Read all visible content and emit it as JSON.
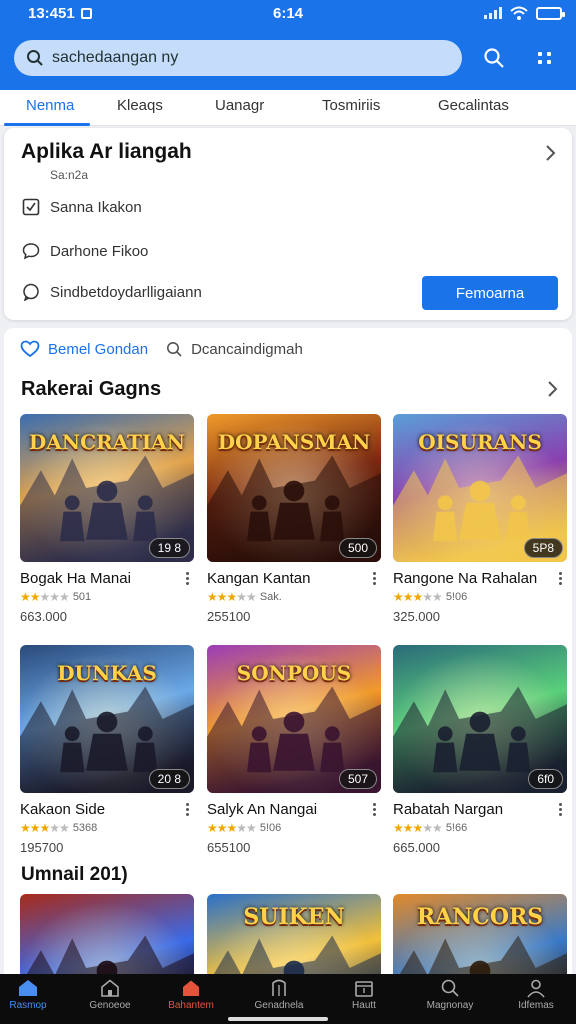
{
  "status": {
    "time": "13:451",
    "center_time": "6:14"
  },
  "search": {
    "query": "sachedaangan ny"
  },
  "tabs": [
    "Nenma",
    "Kleaqs",
    "Uanagr",
    "Tosmiriis",
    "Gecalintas"
  ],
  "app": {
    "title": "Aplika Ar liangah",
    "subtitle": "Sa:n2a",
    "rows": [
      "Sanna Ikakon",
      "Darhone Fikoo",
      "Sindbetdoydarlligaiann"
    ],
    "button": "Femoarna"
  },
  "filters": [
    "Bemel Gondan",
    "Dcancaindigmah"
  ],
  "section_title": "Rakerai Gagns",
  "year_title": "Umnail 201)",
  "games": [
    {
      "name": "Bogak Ha Manai",
      "badge": "19 8",
      "rating_text": "501",
      "stars": 2,
      "price": "663.000",
      "art": "DANCRATIAN",
      "palette": [
        "#3a6db0",
        "#e2a24a",
        "#2d2d4a"
      ]
    },
    {
      "name": "Kangan Kantan",
      "badge": "500",
      "rating_text": "Sak.",
      "stars": 3,
      "price": "255100",
      "art": "DOPANSMAN",
      "palette": [
        "#f09a2a",
        "#7b2a12",
        "#2a0f0a"
      ]
    },
    {
      "name": "Rangone Na Rahalan",
      "badge": "5P8",
      "rating_text": "5!06",
      "stars": 3,
      "price": "325.000",
      "art": "OISURANS",
      "palette": [
        "#5a9fd8",
        "#8a3fae",
        "#f2c64a"
      ]
    },
    {
      "name": "Kakaon Side",
      "badge": "20 8",
      "rating_text": "5368",
      "stars": 3,
      "price": "195700",
      "art": "DUNKAS",
      "palette": [
        "#2b4a7a",
        "#6aa8e8",
        "#1a1a2a"
      ]
    },
    {
      "name": "Salyk An Nangai",
      "badge": "507",
      "rating_text": "5!06",
      "stars": 3,
      "price": "655100",
      "art": "SONPOUS",
      "palette": [
        "#9a3db8",
        "#f09a2a",
        "#3a1530"
      ]
    },
    {
      "name": "Rabatah Nargan",
      "badge": "6f0",
      "rating_text": "5!66",
      "stars": 3,
      "price": "665.000",
      "art": "",
      "palette": [
        "#2a6a7a",
        "#5ad07a",
        "#1a2030"
      ]
    }
  ],
  "partial_games": [
    {
      "art": "",
      "palette": [
        "#a82a1a",
        "#3a6ae8",
        "#1a0a12"
      ]
    },
    {
      "art": "SUIKEN",
      "palette": [
        "#2a70c8",
        "#f2c03a",
        "#1a2a4a"
      ]
    },
    {
      "art": "RANCORS",
      "palette": [
        "#e28a2a",
        "#3a7ac8",
        "#2a1a0a"
      ]
    }
  ],
  "nav": [
    "Rasmop",
    "Genoeoe",
    "Bahantem",
    "Genadnela",
    "Hautt",
    "Magnonay",
    "Idfemas"
  ],
  "colors": {
    "primary": "#1a73e8",
    "header": "#1a73e8",
    "star": "#f0a800"
  }
}
